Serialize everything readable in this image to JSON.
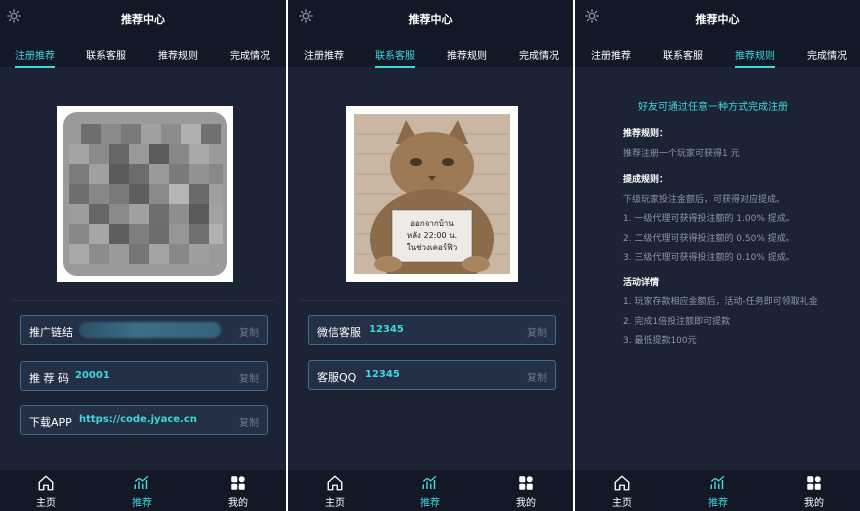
{
  "header": {
    "title": "推荐中心"
  },
  "tabs": [
    "注册推荐",
    "联系客服",
    "推荐规则",
    "完成情况"
  ],
  "panel1": {
    "rows": [
      {
        "label": "推广链结",
        "value": "",
        "copy": "复制"
      },
      {
        "label": "推 荐 码",
        "value": "20001",
        "copy": "复制"
      },
      {
        "label": "下载APP",
        "value": "https://code.jyace.cn",
        "copy": "复制"
      }
    ]
  },
  "panel2": {
    "image_sign": {
      "line1": "ออกจากบ้าน",
      "line2": "หลัง 22:00 น.",
      "line3": "ในช่วงเคอร์ฟิว"
    },
    "rows": [
      {
        "label": "微信客服",
        "value": "12345",
        "copy": "复制"
      },
      {
        "label": "客服QQ",
        "value": "12345",
        "copy": "复制"
      }
    ]
  },
  "panel3": {
    "headline": "好友可通过任意一种方式完成注册",
    "sections": [
      {
        "title": "推荐规则：",
        "lines": [
          "推荐注册一个玩家可获得1 元"
        ]
      },
      {
        "title": "提成规则：",
        "lines": [
          "下级玩家投注金额后，可获得对应提成。",
          "1. 一级代理可获得投注额的 1.00% 提成。",
          "2. 二级代理可获得投注额的 0.50% 提成。",
          "3. 三级代理可获得投注额的 0.10% 提成。"
        ]
      },
      {
        "title": "活动详情",
        "lines": [
          "1. 玩家存款相应金额后，活动-任务即可领取礼金",
          "2. 完成1倍投注额即可提款",
          "3. 最低提款100元"
        ]
      }
    ]
  },
  "nav": [
    {
      "label": "主页",
      "icon": "home-icon"
    },
    {
      "label": "推荐",
      "icon": "trend-icon"
    },
    {
      "label": "我的",
      "icon": "grid-icon"
    }
  ],
  "colors": {
    "accent": "#3fd6dc",
    "panel": "#1c2334",
    "bar": "#121826"
  }
}
